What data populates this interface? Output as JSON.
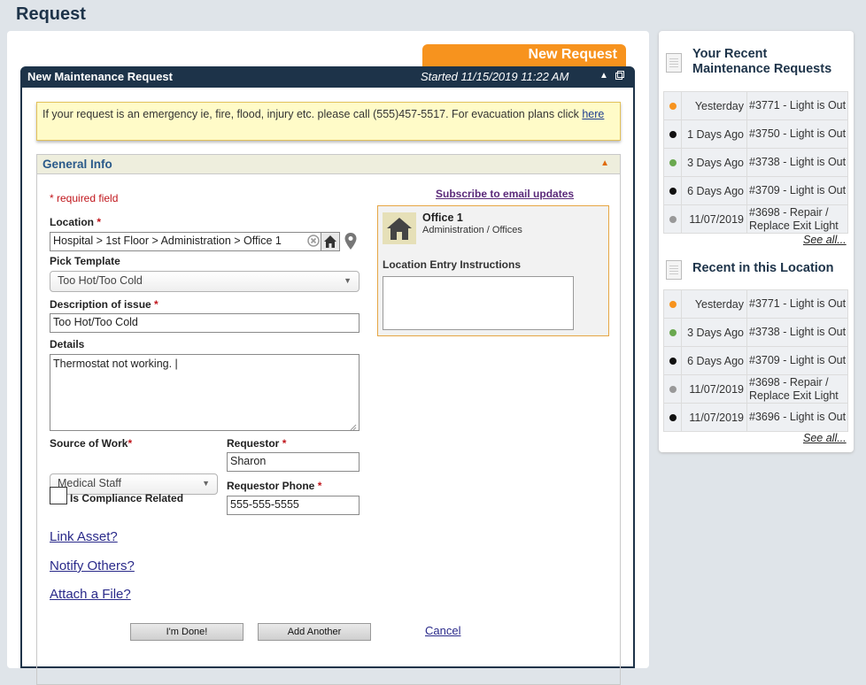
{
  "page": {
    "title": "Request"
  },
  "form": {
    "tab_label": "New Request",
    "header_title": "New Maintenance Request",
    "started": "Started 11/15/2019 11:22 AM",
    "alert_text": "If your request is an emergency ie, fire, flood, injury etc. please call (555)457-5517. For evacuation plans click",
    "alert_link": "here",
    "section_title": "General Info",
    "required_note": "* required field",
    "subscribe_link": "Subscribe to email updates",
    "location_label": "Location",
    "location_value": "Hospital > 1st Floor > Administration > Office 1",
    "template_label": "Pick Template",
    "template_value": "Too Hot/Too Cold",
    "description_label": "Description of issue",
    "description_value": "Too Hot/Too Cold",
    "details_label": "Details",
    "details_value": "Thermostat not working. |",
    "source_label": "Source of Work",
    "source_value": "Medical Staff",
    "requestor_label": "Requestor",
    "requestor_value": "Sharon",
    "phone_label": "Requestor Phone",
    "phone_value": "555-555-5555",
    "compliance_label": "Is Compliance Related",
    "link_asset": "Link Asset?",
    "notify_others": "Notify Others?",
    "attach_file": "Attach a File?",
    "done_button": "I'm Done!",
    "add_another_button": "Add Another",
    "cancel_link": "Cancel",
    "star": "*"
  },
  "location_card": {
    "name": "Office 1",
    "path": "Administration / Offices",
    "instructions_label": "Location Entry Instructions"
  },
  "recent_requests": {
    "title_line1": "Your Recent",
    "title_line2": "Maintenance Requests",
    "see_all": "See all...",
    "rows": [
      {
        "when": "Yesterday",
        "desc": "#3771 - Light is Out",
        "color": "#f7931e"
      },
      {
        "when": "1 Days Ago",
        "desc": "#3750 - Light is Out",
        "color": "#111111"
      },
      {
        "when": "3 Days Ago",
        "desc": "#3738 - Light is Out",
        "color": "#6aa84f"
      },
      {
        "when": "6 Days Ago",
        "desc": "#3709 - Light is Out",
        "color": "#111111"
      },
      {
        "when": "11/07/2019",
        "desc": "#3698 - Repair / Replace Exit Light",
        "color": "#999999"
      }
    ]
  },
  "recent_location": {
    "title": "Recent in this Location",
    "see_all": "See all...",
    "rows": [
      {
        "when": "Yesterday",
        "desc": "#3771 - Light is Out",
        "color": "#f7931e"
      },
      {
        "when": "3 Days Ago",
        "desc": "#3738 - Light is Out",
        "color": "#6aa84f"
      },
      {
        "when": "6 Days Ago",
        "desc": "#3709 - Light is Out",
        "color": "#111111"
      },
      {
        "when": "11/07/2019",
        "desc": "#3698 - Repair / Replace Exit Light",
        "color": "#999999"
      },
      {
        "when": "11/07/2019",
        "desc": "#3696 - Light is Out",
        "color": "#111111"
      }
    ]
  }
}
